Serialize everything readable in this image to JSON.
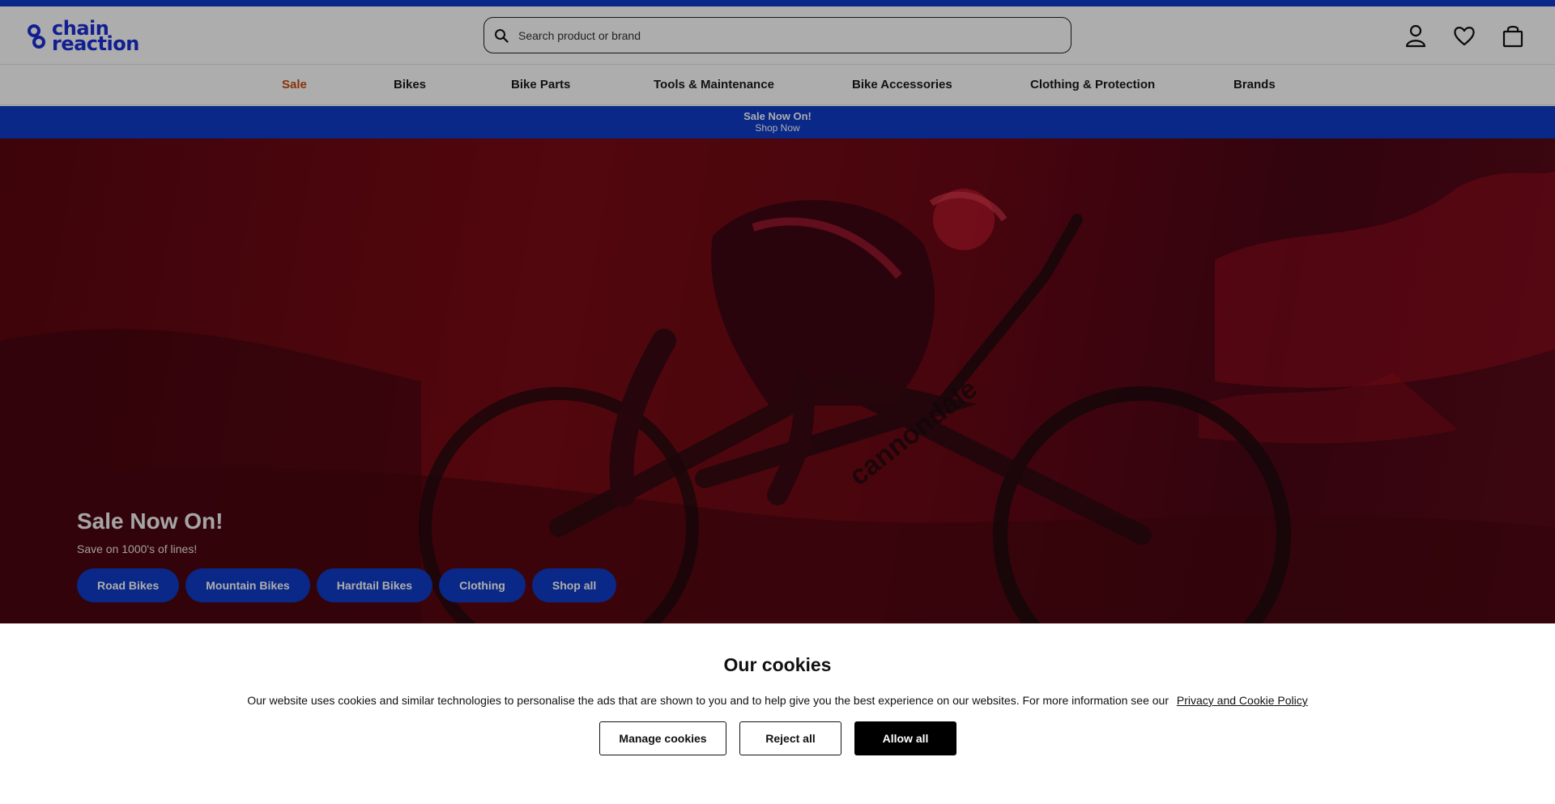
{
  "brand": {
    "logo_text": "chain\nreaction",
    "accent": "#0e3cc8",
    "sale_color": "#c94a0c"
  },
  "search": {
    "placeholder": "Search product or brand",
    "icon": "search-icon"
  },
  "header_icons": [
    "account-icon",
    "wishlist-heart-icon",
    "basket-icon"
  ],
  "nav": {
    "items": [
      {
        "label": "Sale"
      },
      {
        "label": "Bikes"
      },
      {
        "label": "Bike Parts"
      },
      {
        "label": "Tools & Maintenance"
      },
      {
        "label": "Bike Accessories"
      },
      {
        "label": "Clothing & Protection"
      },
      {
        "label": "Brands"
      }
    ]
  },
  "promo": {
    "title": "Sale Now On!",
    "link": "Shop Now"
  },
  "hero": {
    "title": "Sale Now On!",
    "subtitle": "Save on 1000's of lines!",
    "buttons": [
      {
        "label": "Road Bikes"
      },
      {
        "label": "Mountain Bikes"
      },
      {
        "label": "Hardtail Bikes"
      },
      {
        "label": "Clothing"
      },
      {
        "label": "Shop all"
      }
    ],
    "image_text": "cannondale"
  },
  "cookies": {
    "title": "Our cookies",
    "text": "Our website uses cookies and similar technologies to personalise the ads that are shown to you and to help give you the best experience on our websites. For more information see our",
    "policy_link": "Privacy and Cookie Policy",
    "manage_label": "Manage cookies",
    "reject_label": "Reject all",
    "allow_label": "Allow all"
  }
}
